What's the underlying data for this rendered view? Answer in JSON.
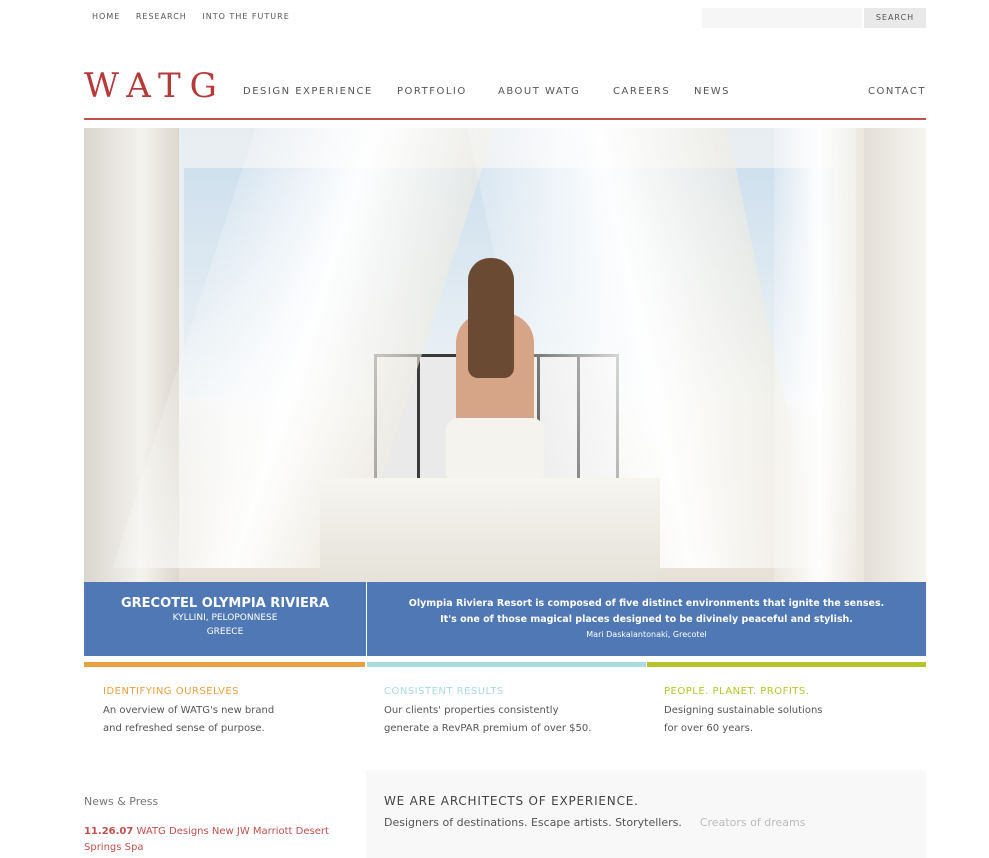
{
  "utility_nav": [
    "HOME",
    "RESEARCH",
    "INTO THE FUTURE"
  ],
  "search": {
    "button": "SEARCH",
    "placeholder": ""
  },
  "logo": "WATG",
  "main_nav": {
    "items": [
      "DESIGN EXPERIENCE",
      "PORTFOLIO",
      "ABOUT WATG",
      "CAREERS",
      "NEWS"
    ],
    "contact": "CONTACT"
  },
  "hero": {
    "title": "GRECOTEL OLYMPIA RIVIERA",
    "location_line1": "KYLLINI, PELOPONNESE",
    "location_line2": "GREECE",
    "quote_line1": "Olympia Riviera Resort is composed of five distinct environments that ignite the senses.",
    "quote_line2": "It's one of those magical places designed to be divinely peaceful and stylish.",
    "credit": "Mari Daskalantonaki, Grecotel"
  },
  "features": [
    {
      "heading": "IDENTIFYING OURSELVES",
      "line1": "An overview of WATG's new brand",
      "line2": "and refreshed sense of purpose.",
      "color": "#e8a040"
    },
    {
      "heading": "CONSISTENT RESULTS",
      "line1": "Our clients' properties consistently",
      "line2": "generate a RevPAR premium of over $50.",
      "color": "#a9dbe0"
    },
    {
      "heading": "PEOPLE. PLANET. PROFITS.",
      "line1": "Designing sustainable solutions",
      "line2": "for over 60 years.",
      "color": "#b5c42c"
    }
  ],
  "news": {
    "heading": "News & Press",
    "date": "11.26.07",
    "headline": "WATG Designs New JW Marriott Desert Springs Spa"
  },
  "tagline": {
    "heading": "WE ARE ARCHITECTS OF EXPERIENCE.",
    "text": "Designers of destinations.  Escape artists.  Storytellers.",
    "faded": "Creators of dreams"
  },
  "colors": {
    "brand": "#b63a3a",
    "caption_bg": "#4f78b4"
  }
}
